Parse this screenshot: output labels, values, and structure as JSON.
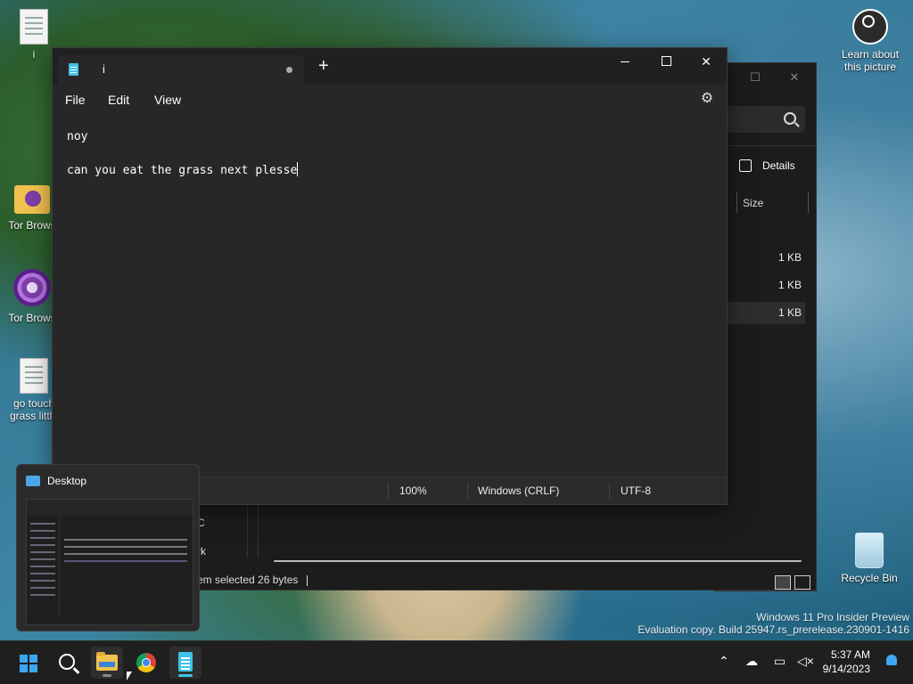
{
  "desktop": {
    "icons": [
      {
        "label": "i"
      },
      {
        "label": "Tor Brows"
      },
      {
        "label": "Tor Brows"
      },
      {
        "label": "go touch grass little"
      }
    ],
    "learn_label": "Learn about this picture",
    "recycle_label": "Recycle Bin",
    "watermark_line1": "Windows 11 Pro Insider Preview",
    "watermark_line2": "Evaluation copy. Build 25947.rs_prerelease.230901-1416"
  },
  "notepad": {
    "tab_title": "i",
    "menu": {
      "file": "File",
      "edit": "Edit",
      "view": "View"
    },
    "lines": [
      "noy",
      "",
      "can you eat the grass next plesse"
    ],
    "status": {
      "zoom": "100%",
      "line_ending": "Windows (CRLF)",
      "encoding": "UTF-8"
    }
  },
  "explorer": {
    "details_label": "Details",
    "size_header": "Size",
    "sizes": [
      "1 KB",
      "1 KB",
      "1 KB"
    ],
    "status_text": "em selected  26 bytes",
    "partial_c": "C",
    "partial_rk": "rk"
  },
  "thumbnail": {
    "title": "Desktop"
  },
  "taskbar": {
    "time": "5:37 AM",
    "date": "9/14/2023"
  }
}
